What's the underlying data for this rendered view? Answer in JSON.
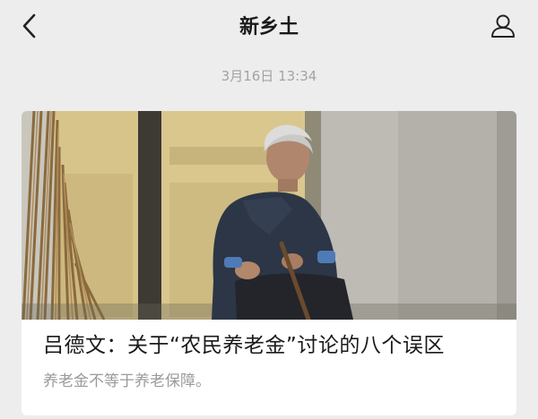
{
  "header": {
    "title": "新乡土",
    "back_icon": "chevron-left-icon",
    "profile_icon": "person-outline-icon"
  },
  "message": {
    "timestamp": "3月16日 13:34"
  },
  "article_card": {
    "image_description_icon": "photo-elderly-woman-seated-doorway",
    "title": "吕德文：关于“农民养老金”讨论的八个误区",
    "subtitle": "养老金不等于养老保障。"
  },
  "colors": {
    "background": "#ededed",
    "card": "#ffffff",
    "title_text": "#1a1a1a",
    "muted_text": "#9a9a9a"
  }
}
